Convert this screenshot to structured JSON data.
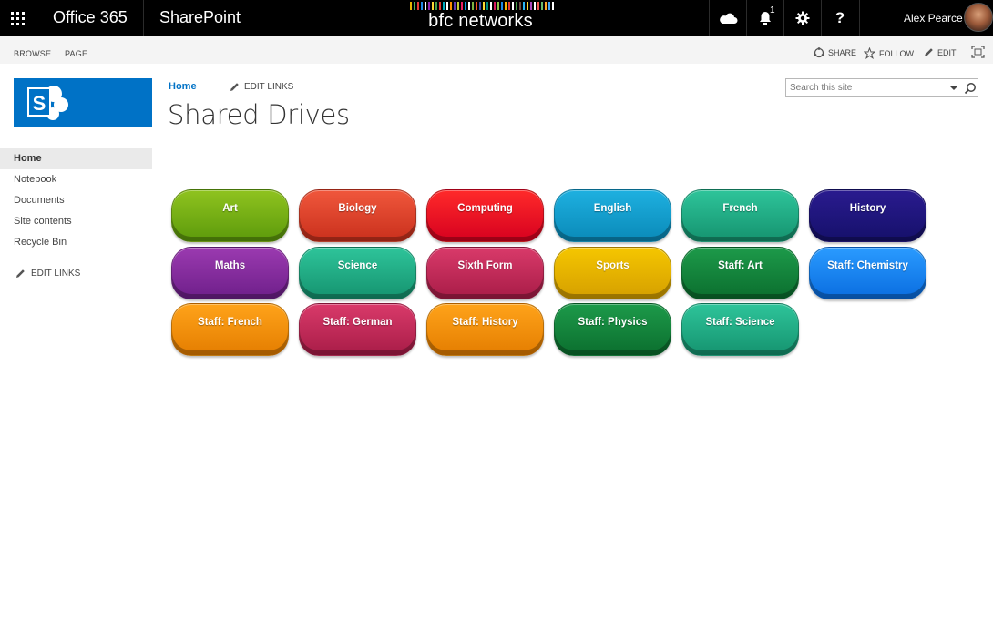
{
  "suitebar": {
    "office": "Office 365",
    "sharepoint": "SharePoint",
    "center_logo": "bfc networks",
    "notification_count": "1",
    "user_name": "Alex Pearce",
    "logo_bar_colors": [
      "#e8b400",
      "#4caf50",
      "#e53935",
      "#1e88e5",
      "#ffffff",
      "#8e24aa",
      "#fdd835",
      "#43a047",
      "#e53935",
      "#00acc1",
      "#ffffff",
      "#fb8c00",
      "#5e35b1",
      "#c0ca33",
      "#e91e63",
      "#039be5",
      "#ffffff",
      "#7cb342",
      "#f4511e",
      "#3949ab",
      "#fdd835",
      "#00897b",
      "#ffffff",
      "#d81b60",
      "#8bc34a",
      "#1e88e5",
      "#ffb300",
      "#e53935",
      "#ffffff",
      "#43a047",
      "#6d4c41",
      "#29b6f6",
      "#fdd835",
      "#ab47bc",
      "#ffffff",
      "#ef5350",
      "#66bb6a",
      "#ffa726",
      "#42a5f5",
      "#ffffff"
    ]
  },
  "ribbon": {
    "browse": "BROWSE",
    "page": "PAGE",
    "share": "SHARE",
    "follow": "FOLLOW",
    "edit": "EDIT"
  },
  "header": {
    "breadcrumb_home": "Home",
    "edit_links": "EDIT LINKS",
    "title": "Shared Drives",
    "search_placeholder": "Search this site"
  },
  "leftnav": {
    "items": [
      {
        "label": "Home",
        "selected": true
      },
      {
        "label": "Notebook",
        "selected": false
      },
      {
        "label": "Documents",
        "selected": false
      },
      {
        "label": "Site contents",
        "selected": false
      },
      {
        "label": "Recycle Bin",
        "selected": false
      }
    ],
    "edit_links": "EDIT LINKS"
  },
  "drives": [
    {
      "label": "Art",
      "color_top": "#8fc31f",
      "color_bottom": "#5c9a0b"
    },
    {
      "label": "Biology",
      "color_top": "#f0573c",
      "color_bottom": "#c9301c"
    },
    {
      "label": "Computing",
      "color_top": "#ff2a2a",
      "color_bottom": "#d6001f"
    },
    {
      "label": "English",
      "color_top": "#1eb0e0",
      "color_bottom": "#0a8ab8"
    },
    {
      "label": "French",
      "color_top": "#2ec49a",
      "color_bottom": "#15936f"
    },
    {
      "label": "History",
      "color_top": "#2a1b8f",
      "color_bottom": "#15106a"
    },
    {
      "label": "Maths",
      "color_top": "#9b3ab0",
      "color_bottom": "#6e1f8a"
    },
    {
      "label": "Science",
      "color_top": "#2ec49a",
      "color_bottom": "#15936f"
    },
    {
      "label": "Sixth Form",
      "color_top": "#d93a6a",
      "color_bottom": "#a81c47"
    },
    {
      "label": "Sports",
      "color_top": "#f5c600",
      "color_bottom": "#d59f00"
    },
    {
      "label": "Staff: Art",
      "color_top": "#1d9a4a",
      "color_bottom": "#0b6e2e"
    },
    {
      "label": "Staff: Chemistry",
      "color_top": "#2a9bff",
      "color_bottom": "#0a6de0"
    },
    {
      "label": "Staff: French",
      "color_top": "#ffa31a",
      "color_bottom": "#e47d00"
    },
    {
      "label": "Staff: German",
      "color_top": "#d93a6a",
      "color_bottom": "#a81c47"
    },
    {
      "label": "Staff: History",
      "color_top": "#ffa31a",
      "color_bottom": "#e47d00"
    },
    {
      "label": "Staff: Physics",
      "color_top": "#1d9a4a",
      "color_bottom": "#0b6e2e"
    },
    {
      "label": "Staff: Science",
      "color_top": "#2ec49a",
      "color_bottom": "#15936f"
    }
  ]
}
